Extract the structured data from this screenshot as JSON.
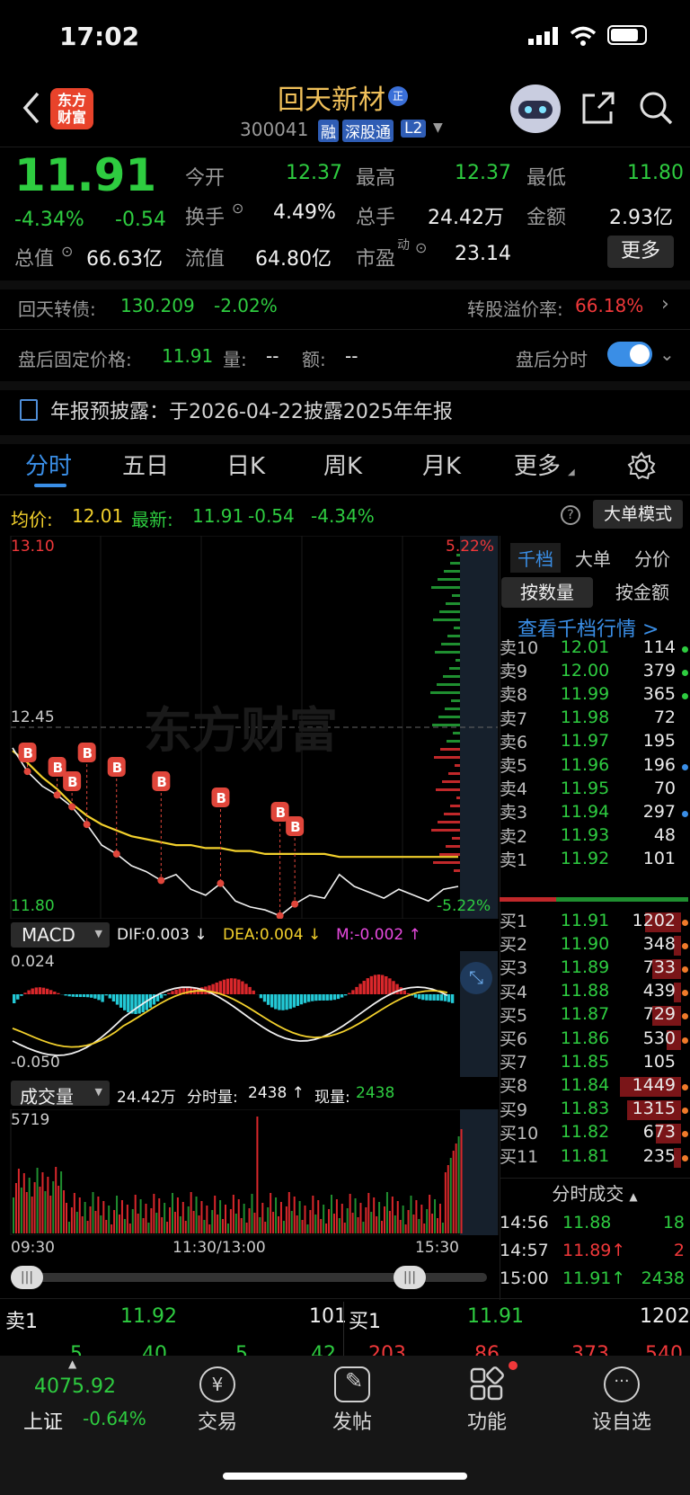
{
  "status_bar": {
    "time": "17:02"
  },
  "header": {
    "logo_text_line1": "东方",
    "logo_text_line2": "财富",
    "stock_name": "回天新材",
    "badge_zheng": "正",
    "code": "300041",
    "tag_rong": "融",
    "tag_sgt": "深股通",
    "tag_l2": "L2"
  },
  "quote": {
    "price": "11.91",
    "change_pct": "-4.34%",
    "change": "-0.54",
    "open_label": "今开",
    "open": "12.37",
    "high_label": "最高",
    "high": "12.37",
    "low_label": "最低",
    "low": "11.80",
    "turnover_label": "换手",
    "turnover": "4.49%",
    "volume_label": "总手",
    "volume": "24.42万",
    "amount_label": "金额",
    "amount": "2.93亿",
    "total_cap_label": "总值",
    "total_cap": "66.63亿",
    "float_cap_label": "流值",
    "float_cap": "64.80亿",
    "pe_label": "市盈",
    "pe_sup": "动",
    "pe": "23.14",
    "more_button": "更多"
  },
  "bond": {
    "label": "回天转债:",
    "price": "130.209",
    "change": "-2.02%",
    "premium_label": "转股溢价率:",
    "premium": "66.18%"
  },
  "after_hours": {
    "label": "盘后固定价格:",
    "price": "11.91",
    "vol_label": "量:",
    "vol": "--",
    "amt_label": "额:",
    "amt": "--",
    "toggle_label": "盘后分时"
  },
  "notice": {
    "text": "年报预披露：于2026-04-22披露2025年年报"
  },
  "tabs": [
    "分时",
    "五日",
    "日K",
    "周K",
    "月K",
    "更多"
  ],
  "chart_header": {
    "avg_label": "均价:",
    "avg": "12.01",
    "latest_label": "最新:",
    "latest": "11.91",
    "latest_change": "-0.54",
    "latest_pct": "-4.34%",
    "mode_button": "大单模式"
  },
  "price_chart": {
    "top_price": "13.10",
    "mid_price": "12.45",
    "bottom_price": "11.80",
    "top_pct": "5.22%",
    "bottom_pct": "-5.22%",
    "watermark": "东方财富",
    "b_marker": "B"
  },
  "macd": {
    "name": "MACD",
    "dif": "DIF:0.003 ↓",
    "dea": "DEA:0.004 ↓",
    "m": "M:-0.002 ↑",
    "top": "0.024",
    "bottom": "-0.050"
  },
  "volume_panel": {
    "name": "成交量",
    "total": "24.42万",
    "period_label": "分时量:",
    "period": "2438 ↑",
    "now_label": "现量:",
    "now": "2438",
    "max": "5719",
    "time_start": "09:30",
    "time_mid": "11:30/13:00",
    "time_end": "15:30"
  },
  "chart_data": {
    "type": "line",
    "title": "",
    "ylim": [
      11.8,
      13.1
    ],
    "series": [
      {
        "name": "最新",
        "values": [
          12.38,
          12.3,
          12.25,
          12.22,
          12.18,
          12.12,
          12.05,
          12.02,
          11.98,
          11.96,
          11.93,
          11.95,
          11.9,
          11.88,
          11.92,
          11.86,
          11.84,
          11.83,
          11.81,
          11.85,
          11.88,
          11.87,
          11.95,
          11.91,
          11.89,
          11.87,
          11.9,
          11.88,
          11.86,
          11.9,
          11.91
        ]
      },
      {
        "name": "均价",
        "values": [
          12.37,
          12.33,
          12.28,
          12.24,
          12.19,
          12.15,
          12.12,
          12.1,
          12.08,
          12.07,
          12.06,
          12.05,
          12.05,
          12.04,
          12.04,
          12.03,
          12.03,
          12.02,
          12.02,
          12.02,
          12.02,
          12.02,
          12.01,
          12.01,
          12.01,
          12.01,
          12.01,
          12.01,
          12.01,
          12.01,
          12.01
        ]
      }
    ]
  },
  "side_tabs": [
    "千档",
    "大单",
    "分价"
  ],
  "side_toggle": [
    "按数量",
    "按金额"
  ],
  "side_link": "查看千档行情 >",
  "asks": [
    {
      "label": "卖10",
      "price": "12.01",
      "vol": "114",
      "dot": "green"
    },
    {
      "label": "卖9",
      "price": "12.00",
      "vol": "379",
      "dot": "green"
    },
    {
      "label": "卖8",
      "price": "11.99",
      "vol": "365",
      "dot": "green"
    },
    {
      "label": "卖7",
      "price": "11.98",
      "vol": "72",
      "dot": ""
    },
    {
      "label": "卖6",
      "price": "11.97",
      "vol": "195",
      "dot": ""
    },
    {
      "label": "卖5",
      "price": "11.96",
      "vol": "196",
      "dot": "blue"
    },
    {
      "label": "卖4",
      "price": "11.95",
      "vol": "70",
      "dot": ""
    },
    {
      "label": "卖3",
      "price": "11.94",
      "vol": "297",
      "dot": "blue"
    },
    {
      "label": "卖2",
      "price": "11.93",
      "vol": "48",
      "dot": ""
    },
    {
      "label": "卖1",
      "price": "11.92",
      "vol": "101",
      "dot": ""
    }
  ],
  "bids": [
    {
      "label": "买1",
      "price": "11.91",
      "vol": "1202",
      "dot": "orange",
      "bar": 0.5
    },
    {
      "label": "买2",
      "price": "11.90",
      "vol": "348",
      "dot": "orange",
      "bar": 0.1
    },
    {
      "label": "买3",
      "price": "11.89",
      "vol": "733",
      "dot": "orange",
      "bar": 0.4
    },
    {
      "label": "买4",
      "price": "11.88",
      "vol": "439",
      "dot": "orange",
      "bar": 0.1
    },
    {
      "label": "买5",
      "price": "11.87",
      "vol": "729",
      "dot": "orange",
      "bar": 0.4
    },
    {
      "label": "买6",
      "price": "11.86",
      "vol": "530",
      "dot": "orange",
      "bar": 0.2
    },
    {
      "label": "买7",
      "price": "11.85",
      "vol": "105",
      "dot": "",
      "bar": 0
    },
    {
      "label": "买8",
      "price": "11.84",
      "vol": "1449",
      "dot": "orange",
      "bar": 0.85
    },
    {
      "label": "买9",
      "price": "11.83",
      "vol": "1315",
      "dot": "orange",
      "bar": 0.75
    },
    {
      "label": "买10",
      "price": "11.82",
      "vol": "673",
      "dot": "orange",
      "bar": 0.35
    },
    {
      "label": "买11",
      "price": "11.81",
      "vol": "235",
      "dot": "orange",
      "bar": 0.1
    }
  ],
  "ticks_header": "分时成交",
  "ticks": [
    {
      "time": "14:56",
      "price": "11.88",
      "arrow": "",
      "vol": "18",
      "color": "green"
    },
    {
      "time": "14:57",
      "price": "11.89",
      "arrow": "↑",
      "vol": "2",
      "color": "red"
    },
    {
      "time": "15:00",
      "price": "11.91",
      "arrow": "↑",
      "vol": "2438",
      "color": "green"
    }
  ],
  "bottom_quote": {
    "sell_label": "卖1",
    "sell_price": "11.92",
    "sell_vol": "101",
    "buy_label": "买1",
    "buy_price": "11.91",
    "buy_vol": "1202",
    "partial": [
      "5",
      "40",
      "5",
      "42",
      "203",
      "86",
      "373",
      "540"
    ]
  },
  "bottom_nav": {
    "index_value": "4075.92",
    "index_name": "上证",
    "index_change": "-0.64%",
    "items": [
      "交易",
      "发帖",
      "功能",
      "设自选"
    ]
  },
  "colors": {
    "up": "#f0383a",
    "down": "#2ecc40",
    "accent": "#3a8ee6",
    "avg_line": "#f2d02c"
  }
}
